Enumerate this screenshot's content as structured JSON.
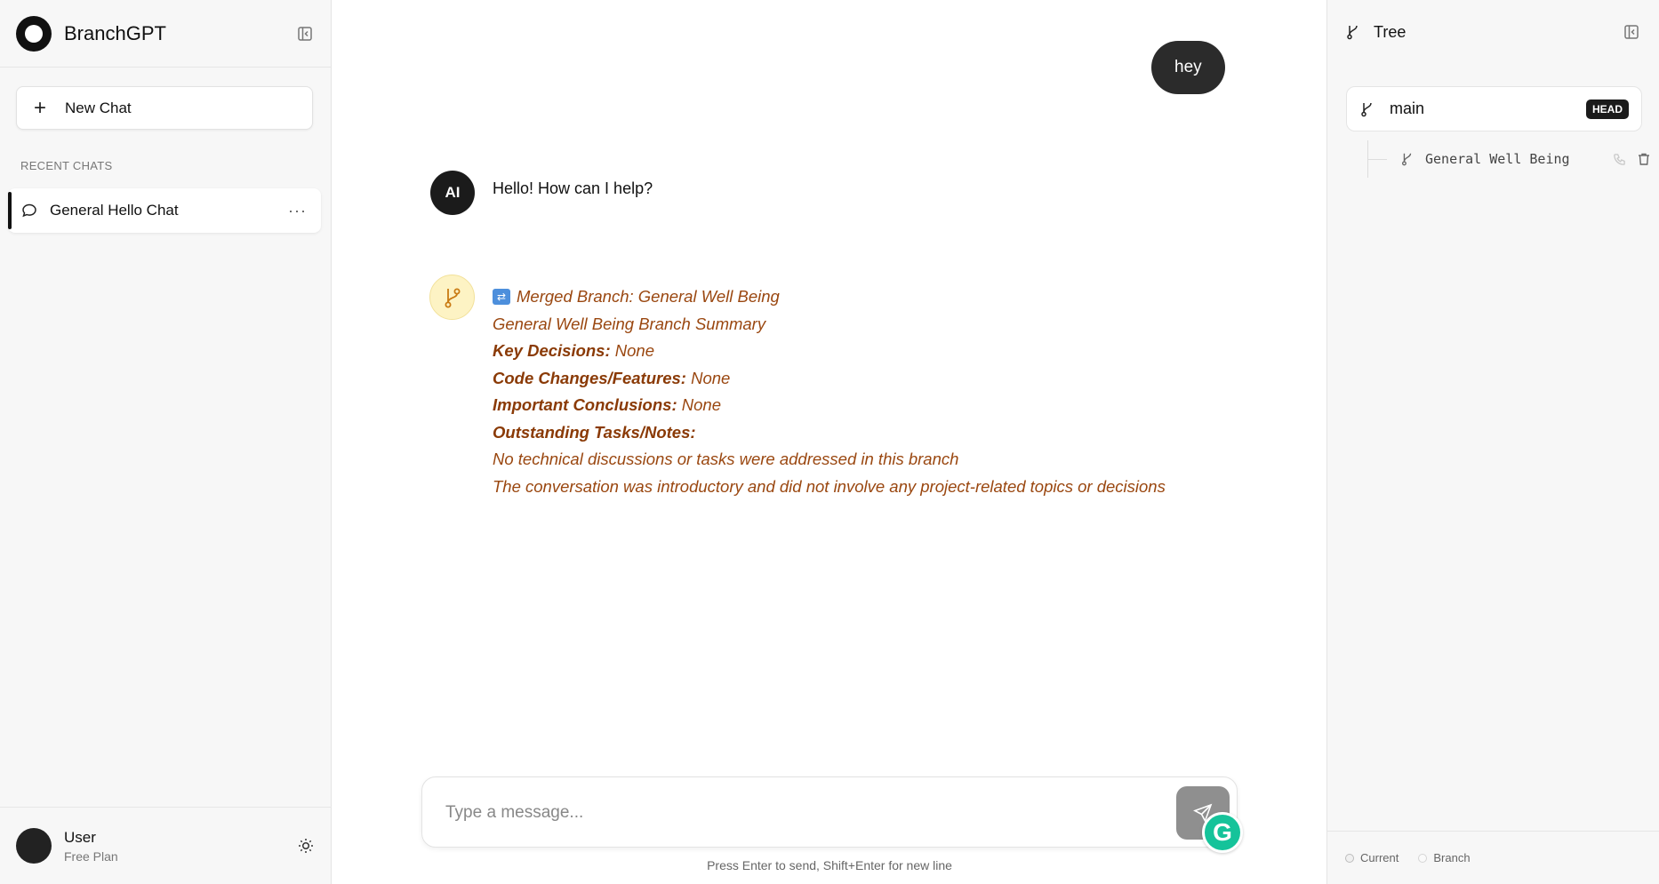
{
  "app": {
    "name": "BranchGPT"
  },
  "sidebar": {
    "new_chat_label": "New Chat",
    "recent_title": "RECENT CHATS",
    "chats": [
      {
        "label": "General Hello Chat"
      }
    ],
    "user": {
      "name": "User",
      "plan": "Free Plan"
    }
  },
  "conversation": {
    "user_message": "hey",
    "ai_avatar": "AI",
    "ai_message": "Hello! How can I help?",
    "merge": {
      "title": "Merged Branch: General Well Being",
      "summary": "General Well Being Branch Summary",
      "key_decisions_label": "Key Decisions:",
      "key_decisions_value": "None",
      "code_changes_label": "Code Changes/Features:",
      "code_changes_value": "None",
      "conclusions_label": "Important Conclusions:",
      "conclusions_value": "None",
      "tasks_label": "Outstanding Tasks/Notes:",
      "note_1": "No technical discussions or tasks were addressed in this branch",
      "note_2": "The conversation was introductory and did not involve any project-related topics or decisions"
    }
  },
  "composer": {
    "placeholder": "Type a message...",
    "hint": "Press Enter to send, Shift+Enter for new line"
  },
  "tree": {
    "title": "Tree",
    "main_branch": "main",
    "head_badge": "HEAD",
    "child_branch": "General Well Being",
    "legend_current": "Current",
    "legend_branch": "Branch"
  },
  "colors": {
    "merge_text": "#9a4710",
    "merge_avatar_bg": "#fdf3c4",
    "user_bubble": "#2b2b2b",
    "grammarly": "#15c39a"
  },
  "icons": [
    "panel-collapse-icon",
    "plus-icon",
    "chat-bubble-icon",
    "more-icon",
    "sun-icon",
    "merge-icon",
    "branch-icon",
    "send-icon",
    "phone-icon",
    "trash-icon",
    "grammarly-icon"
  ]
}
